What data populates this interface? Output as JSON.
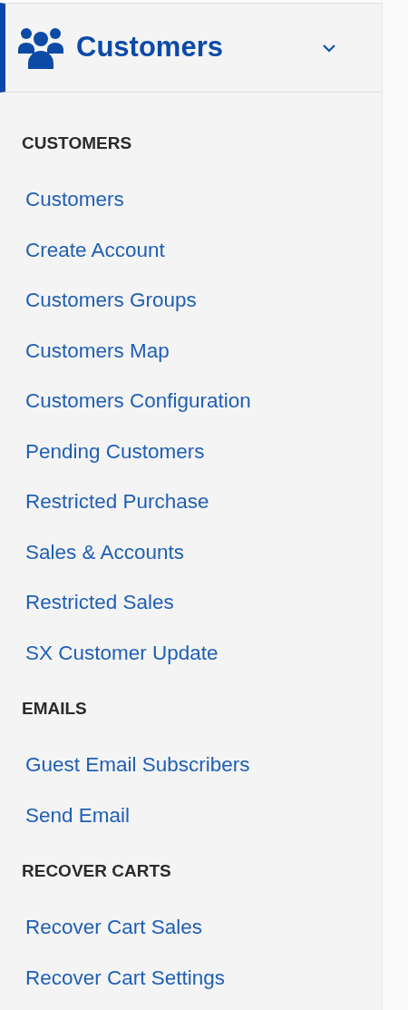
{
  "header": {
    "title": "Customers",
    "active": true,
    "expanded": true
  },
  "sections": [
    {
      "heading": "CUSTOMERS",
      "links": [
        "Customers",
        "Create Account",
        "Customers Groups",
        "Customers Map",
        "Customers Configuration",
        "Pending Customers",
        "Restricted Purchase",
        "Sales & Accounts",
        "Restricted Sales",
        "SX Customer Update"
      ]
    },
    {
      "heading": "EMAILS",
      "links": [
        "Guest Email Subscribers",
        "Send Email"
      ]
    },
    {
      "heading": "RECOVER CARTS",
      "links": [
        "Recover Cart Sales",
        "Recover Cart Settings"
      ]
    }
  ]
}
